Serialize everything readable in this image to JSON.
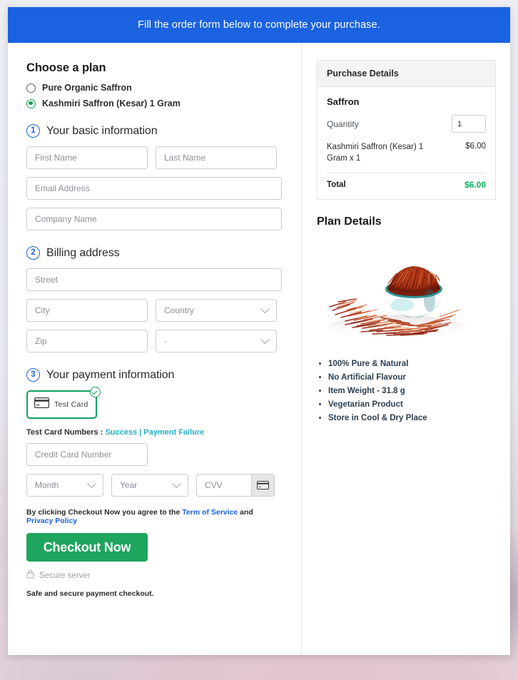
{
  "banner": {
    "text": "Fill the order form below to complete your purchase."
  },
  "left": {
    "choose_plan_title": "Choose a plan",
    "plans": [
      {
        "label": "Pure Organic Saffron",
        "selected": false
      },
      {
        "label": "Kashmiri Saffron (Kesar) 1 Gram",
        "selected": true
      }
    ],
    "step1": {
      "num": "1",
      "title": "Your basic information"
    },
    "basic_fields": {
      "first_name": "First Name",
      "last_name": "Last Name",
      "email": "Email Address",
      "company": "Company Name"
    },
    "step2": {
      "num": "2",
      "title": "Billing address"
    },
    "billing_fields": {
      "street": "Street",
      "city": "City",
      "country": "Country",
      "zip": "Zip",
      "state": "-"
    },
    "step3": {
      "num": "3",
      "title": "Your payment information"
    },
    "payment": {
      "card_tile_label": "Test Card",
      "test_numbers_prefix": "Test Card Numbers :",
      "success_link": "Success",
      "separator": "|",
      "failure_link": "Payment Failure",
      "credit_card_number": "Credit Card Number",
      "month": "Month",
      "year": "Year",
      "cvv": "CVV"
    },
    "agree": {
      "prefix": "By clicking Checkout Now you agree to the",
      "terms_link": "Term of Service",
      "and": "and",
      "privacy_link": "Privacy Policy"
    },
    "checkout_button": "Checkout Now",
    "secure_server": "Secure server",
    "safe_note": "Safe and secure payment checkout."
  },
  "right": {
    "purchase_details_header": "Purchase Details",
    "product_title": "Saffron",
    "quantity_label": "Quantity",
    "quantity_value": "1",
    "line_item_name": "Kashmiri Saffron (Kesar) 1 Gram x 1",
    "line_item_price": "$6.00",
    "total_label": "Total",
    "total_value": "$6.00",
    "plan_details_title": "Plan Details",
    "features": [
      "100% Pure & Natural",
      "No Artificial Flavour",
      "Item Weight - 31.8 g",
      "Vegetarian Product",
      "Store in Cool & Dry Place"
    ]
  },
  "colors": {
    "banner_blue": "#1a62e0",
    "accent_green": "#13a05c",
    "button_green": "#1ea55e",
    "total_green": "#0fb15c",
    "link_teal": "#24b0c4",
    "link_blue": "#1a62e0"
  }
}
